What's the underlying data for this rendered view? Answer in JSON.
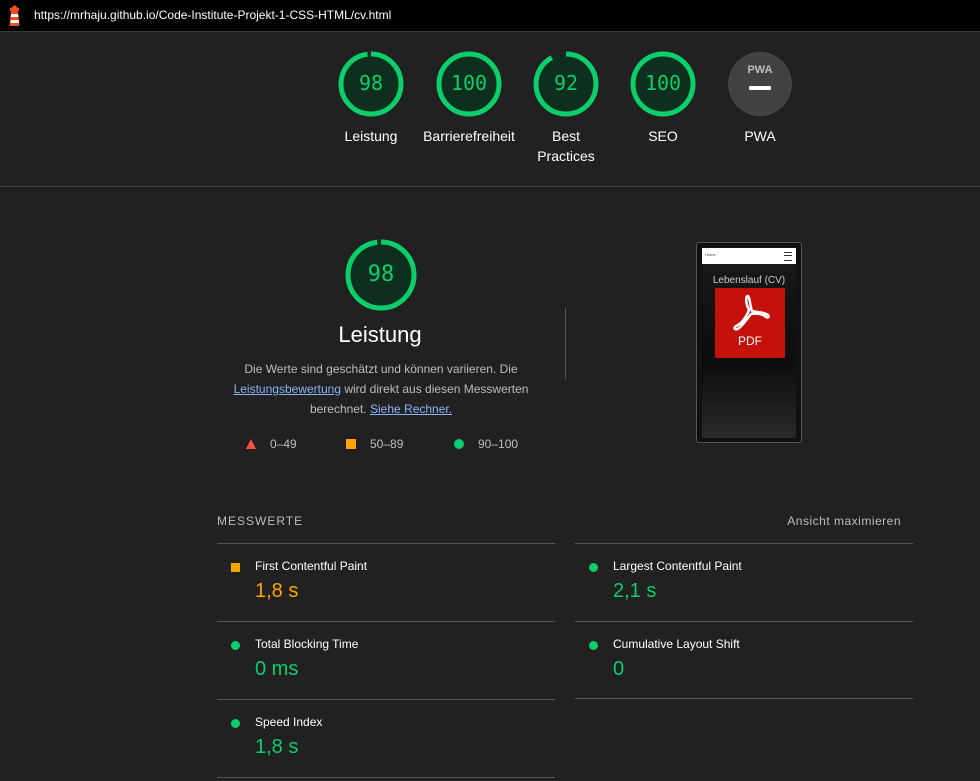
{
  "browser": {
    "url": "https://mrhaju.github.io/Code-Institute-Projekt-1-CSS-HTML/cv.html"
  },
  "colors": {
    "pass": "#0cce6b",
    "average": "#ffa400",
    "fail": "#ff4e42",
    "background": "#212121"
  },
  "scores": [
    {
      "label": "Leistung",
      "score": "98",
      "progress": 98
    },
    {
      "label": "Barrierefreiheit",
      "score": "100",
      "progress": 100
    },
    {
      "label": "Best Practices",
      "score": "92",
      "progress": 92
    },
    {
      "label": "SEO",
      "score": "100",
      "progress": 100
    },
    {
      "label": "PWA",
      "score": "PWA",
      "icon": "pwa-badge-icon"
    }
  ],
  "performance": {
    "score": "98",
    "progress": 98,
    "title": "Leistung",
    "desc_1": "Die Werte sind geschätzt und können variieren. Die",
    "desc_link": "Leistungsbewertung",
    "desc_2": "wird direkt aus diesen Messwerten berechnet.",
    "calc_link": "Siehe Rechner.",
    "legend": [
      {
        "icon": "triangle-icon",
        "range": "0–49"
      },
      {
        "icon": "square-icon",
        "range": "50–89"
      },
      {
        "icon": "circle-icon",
        "range": "90–100"
      }
    ]
  },
  "screenshot": {
    "title": "Lebenslauf (CV)",
    "pdf_label": "PDF",
    "nav_text": "Home"
  },
  "metrics": {
    "heading": "MESSWERTE",
    "toggle": "Ansicht maximieren",
    "items": [
      {
        "title": "First Contentful Paint",
        "value": "1,8 s",
        "status": "orange"
      },
      {
        "title": "Largest Contentful Paint",
        "value": "2,1 s",
        "status": "green"
      },
      {
        "title": "Total Blocking Time",
        "value": "0 ms",
        "status": "green"
      },
      {
        "title": "Cumulative Layout Shift",
        "value": "0",
        "status": "green"
      },
      {
        "title": "Speed Index",
        "value": "1,8 s",
        "status": "green"
      }
    ]
  }
}
